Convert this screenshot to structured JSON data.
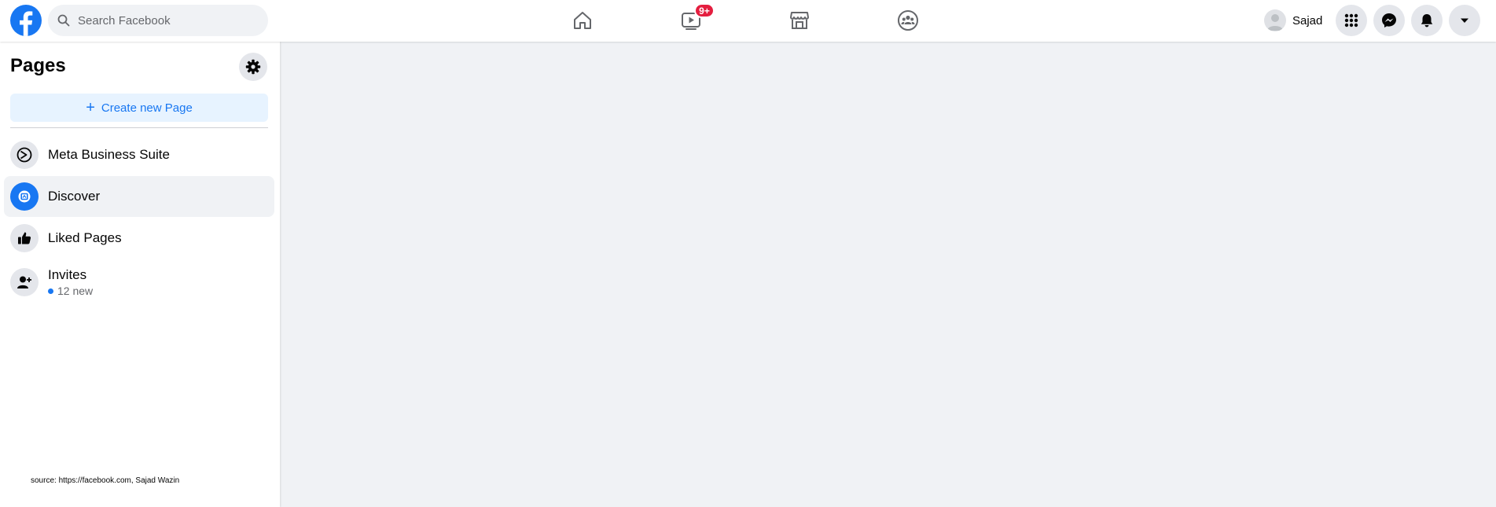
{
  "topbar": {
    "search": {
      "placeholder": "Search Facebook"
    },
    "nav": [
      {
        "name": "home-icon"
      },
      {
        "name": "video-icon",
        "badge": "9+"
      },
      {
        "name": "marketplace-icon"
      },
      {
        "name": "groups-icon"
      }
    ],
    "profile": {
      "name": "Sajad"
    },
    "buttons": [
      "menu-grid-icon",
      "messenger-icon",
      "notifications-bell-icon",
      "account-dropdown-icon"
    ]
  },
  "sidebar": {
    "title": "Pages",
    "create_label": "Create new Page",
    "items": [
      {
        "label": "Meta Business Suite",
        "icon": "meta-business-suite-icon"
      },
      {
        "label": "Discover",
        "icon": "discover-icon",
        "active": true
      },
      {
        "label": "Liked Pages",
        "icon": "thumbs-up-icon"
      },
      {
        "label": "Invites",
        "sub": "12 new",
        "icon": "add-person-icon"
      }
    ]
  },
  "footer": {
    "source": "source: https://facebook.com, Sajad Wazin"
  },
  "colors": {
    "brand": "#1877f2",
    "badge": "#e41e3f",
    "background": "#f0f2f5"
  }
}
